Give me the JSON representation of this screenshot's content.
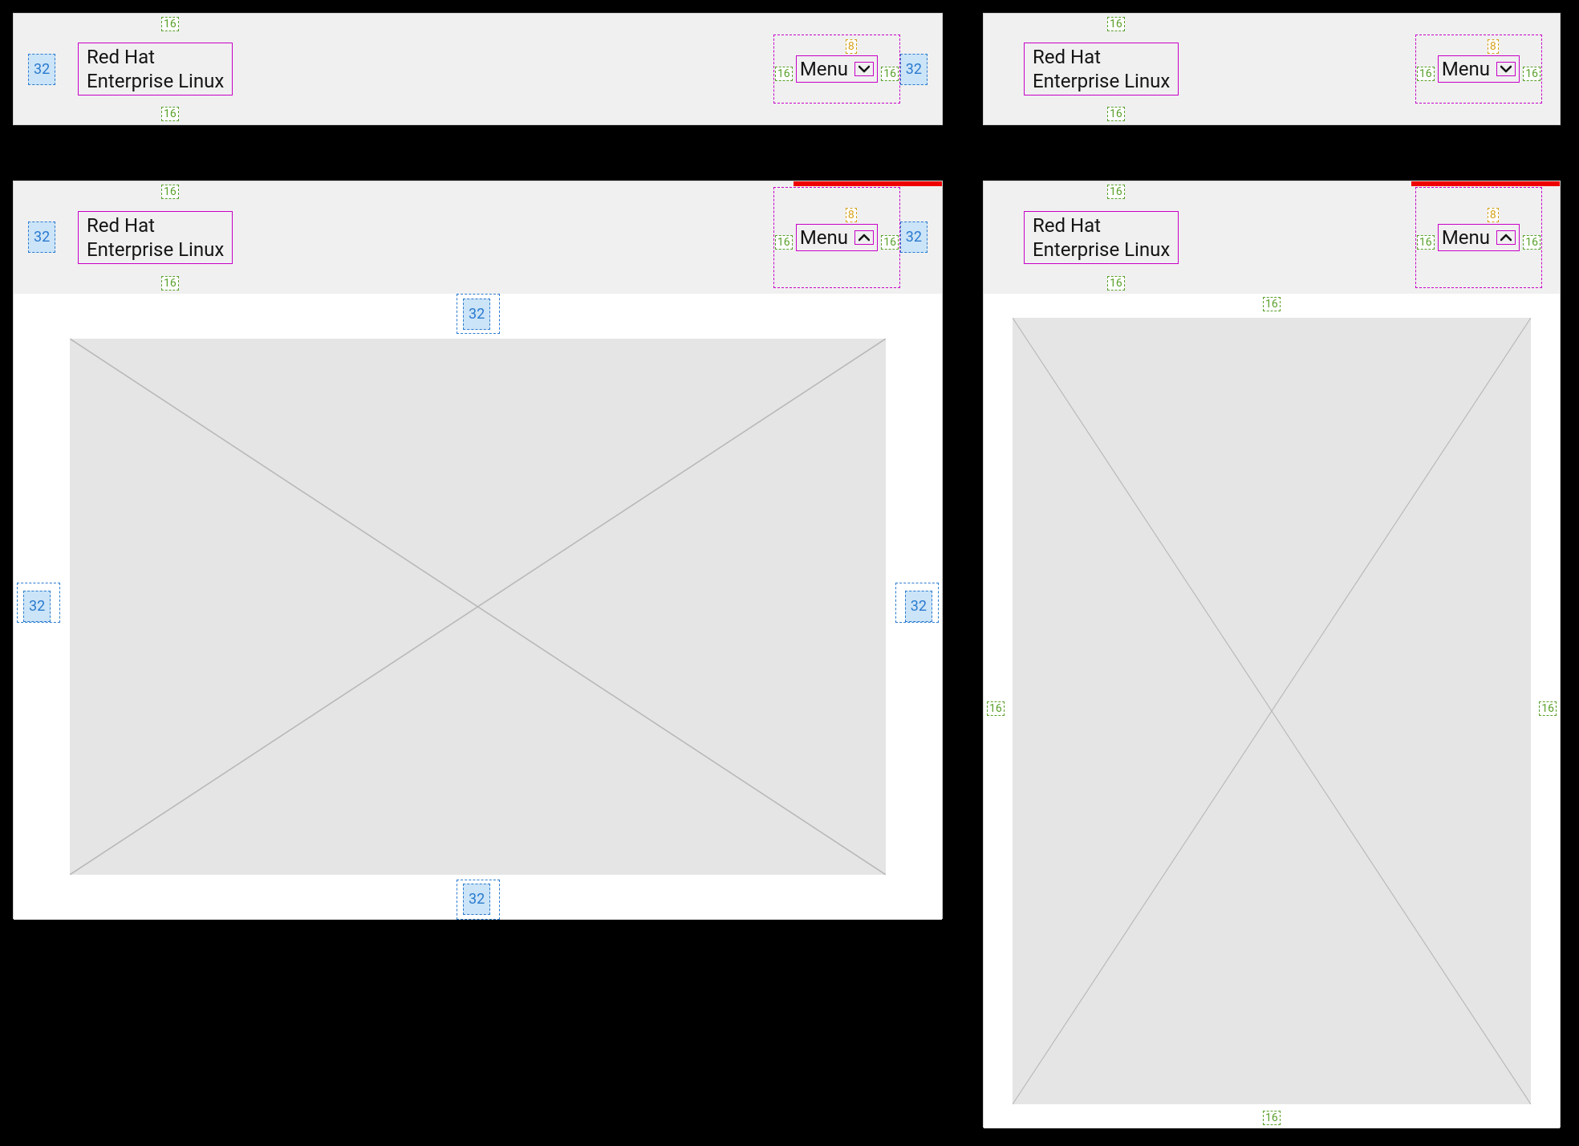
{
  "spec": {
    "title_line1": "Red Hat",
    "title_line2": "Enterprise Linux",
    "menu_label": "Menu",
    "gap_menu_icon": "8",
    "pad_header_v": "16",
    "pad_menu_h": "16",
    "pad_large": "32",
    "pad_small": "16"
  }
}
